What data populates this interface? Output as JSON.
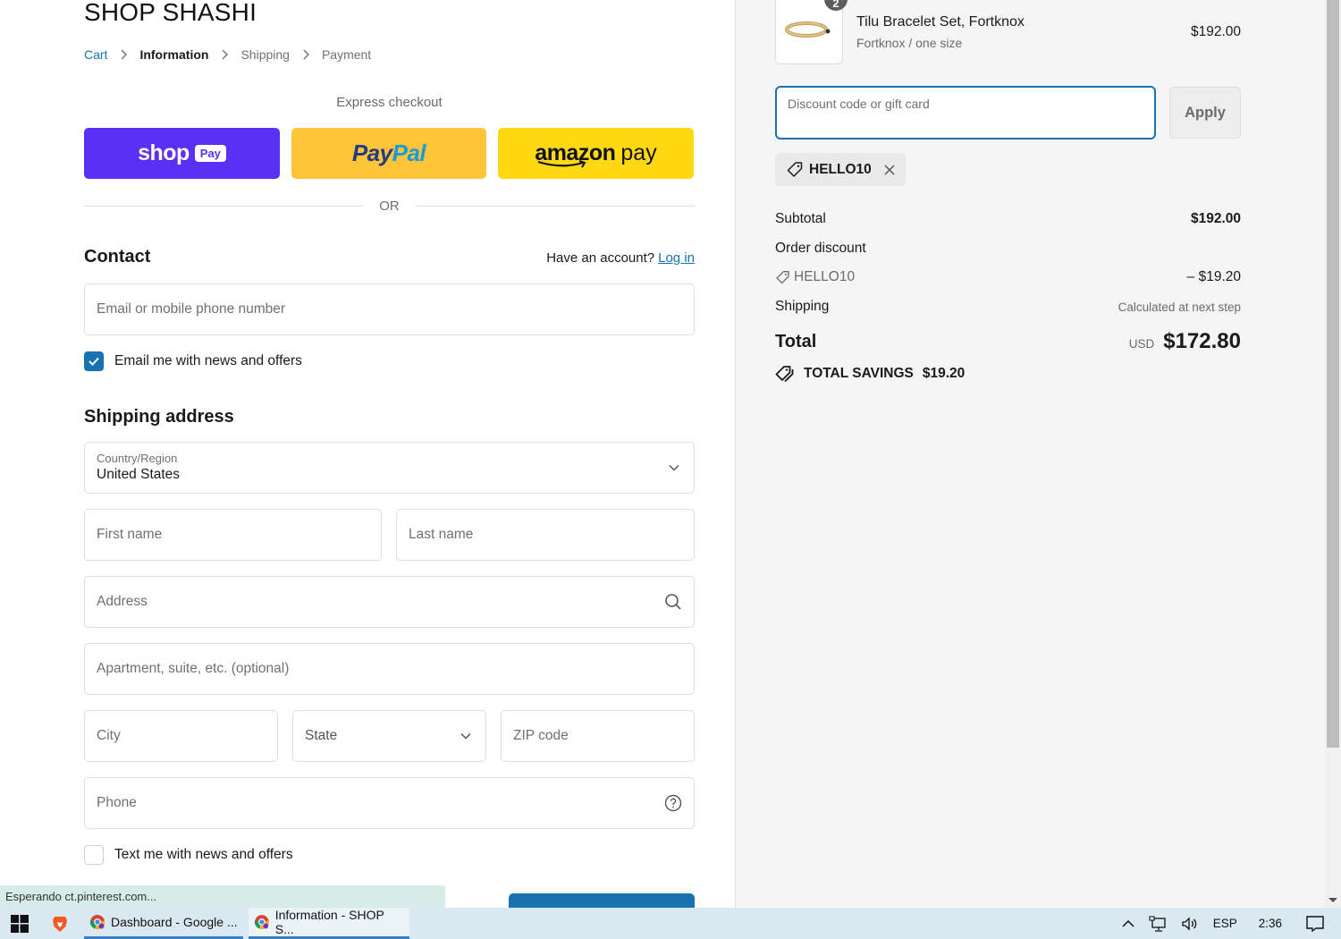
{
  "store": {
    "name": "SHOP SHASHI"
  },
  "breadcrumb": [
    {
      "label": "Cart",
      "state": "link"
    },
    {
      "label": "Information",
      "state": "current"
    },
    {
      "label": "Shipping",
      "state": "upcoming"
    },
    {
      "label": "Payment",
      "state": "upcoming"
    }
  ],
  "express": {
    "title": "Express checkout",
    "shop_pay": {
      "word": "shop",
      "badge": "Pay"
    },
    "paypal": {
      "part1": "Pay",
      "part2": "Pal"
    },
    "amazon_pay": {
      "word1": "amazon",
      "word2": "pay"
    },
    "divider": "OR"
  },
  "contact": {
    "heading": "Contact",
    "have_account": "Have an account?",
    "login_link": "Log in",
    "email_placeholder": "Email or mobile phone number",
    "email_offers_label": "Email me with news and offers",
    "email_offers_checked": true
  },
  "shipping": {
    "heading": "Shipping address",
    "country_label": "Country/Region",
    "country_value": "United States",
    "first_name_placeholder": "First name",
    "last_name_placeholder": "Last name",
    "address_placeholder": "Address",
    "apartment_placeholder": "Apartment, suite, etc. (optional)",
    "city_placeholder": "City",
    "state_placeholder": "State",
    "zip_placeholder": "ZIP code",
    "phone_placeholder": "Phone",
    "text_offers_label": "Text me with news and offers",
    "text_offers_checked": false
  },
  "order": {
    "item": {
      "name": "Tilu Bracelet Set, Fortknox",
      "variant": "Fortknox / one size",
      "price": "$192.00",
      "quantity": "2"
    },
    "discount_placeholder": "Discount code or gift card",
    "apply_label": "Apply",
    "applied_code": "HELLO10",
    "subtotal_label": "Subtotal",
    "subtotal_value": "$192.00",
    "order_discount_label": "Order discount",
    "discount_code": "HELLO10",
    "discount_value": "– $19.20",
    "shipping_label": "Shipping",
    "shipping_value": "Calculated at next step",
    "total_label": "Total",
    "currency": "USD",
    "total_value": "$172.80",
    "savings_label": "TOTAL SAVINGS",
    "savings_value": "$19.20"
  },
  "browser": {
    "status_text": "Esperando ct.pinterest.com..."
  },
  "taskbar": {
    "apps": [
      {
        "label": "Dashboard - Google ...",
        "icon": "chrome-icon"
      },
      {
        "label": "Information - SHOP S...",
        "icon": "chrome-icon",
        "active": true
      }
    ],
    "language": "ESP",
    "time": "2:36"
  }
}
